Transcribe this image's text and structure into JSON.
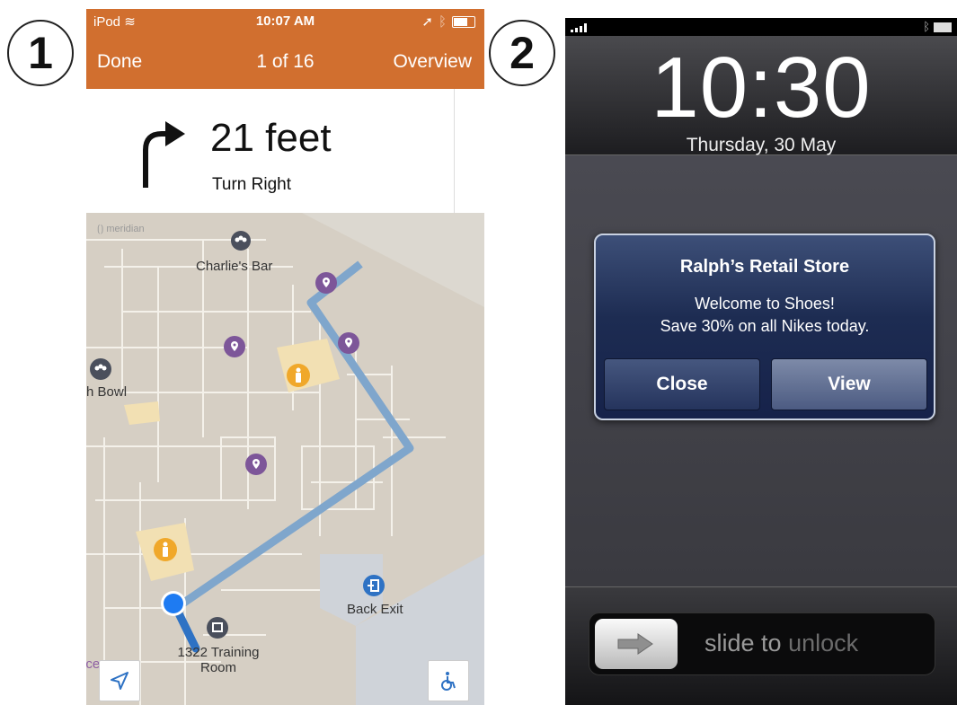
{
  "badges": [
    "1",
    "2"
  ],
  "phone1": {
    "status": {
      "carrier": "iPod",
      "time": "10:07 AM"
    },
    "nav": {
      "done": "Done",
      "counter": "1 of 16",
      "overview": "Overview"
    },
    "instruction": {
      "distance": "21 feet",
      "direction": "Turn Right"
    },
    "map": {
      "brand": "meridian",
      "labels": {
        "charlies_bar": "Charlie's Bar",
        "bowl": "h Bowl",
        "back_exit": "Back Exit",
        "training_1": "1322 Training",
        "training_2": "Room",
        "ice": "ice"
      }
    },
    "colors": {
      "header": "#d16f2f",
      "route": "#7fa6cc",
      "poi": "#7d5699",
      "restroom": "#f0a82a",
      "location": "#1e7bf2"
    }
  },
  "phone2": {
    "clock": "10:30",
    "date": "Thursday, 30 May",
    "alert": {
      "title": "Ralph’s Retail Store",
      "line1": "Welcome to Shoes!",
      "line2": "Save 30% on all Nikes today.",
      "close": "Close",
      "view": "View"
    },
    "slider": {
      "slide": "slide",
      "to": "to",
      "unlock": "unlock"
    }
  }
}
